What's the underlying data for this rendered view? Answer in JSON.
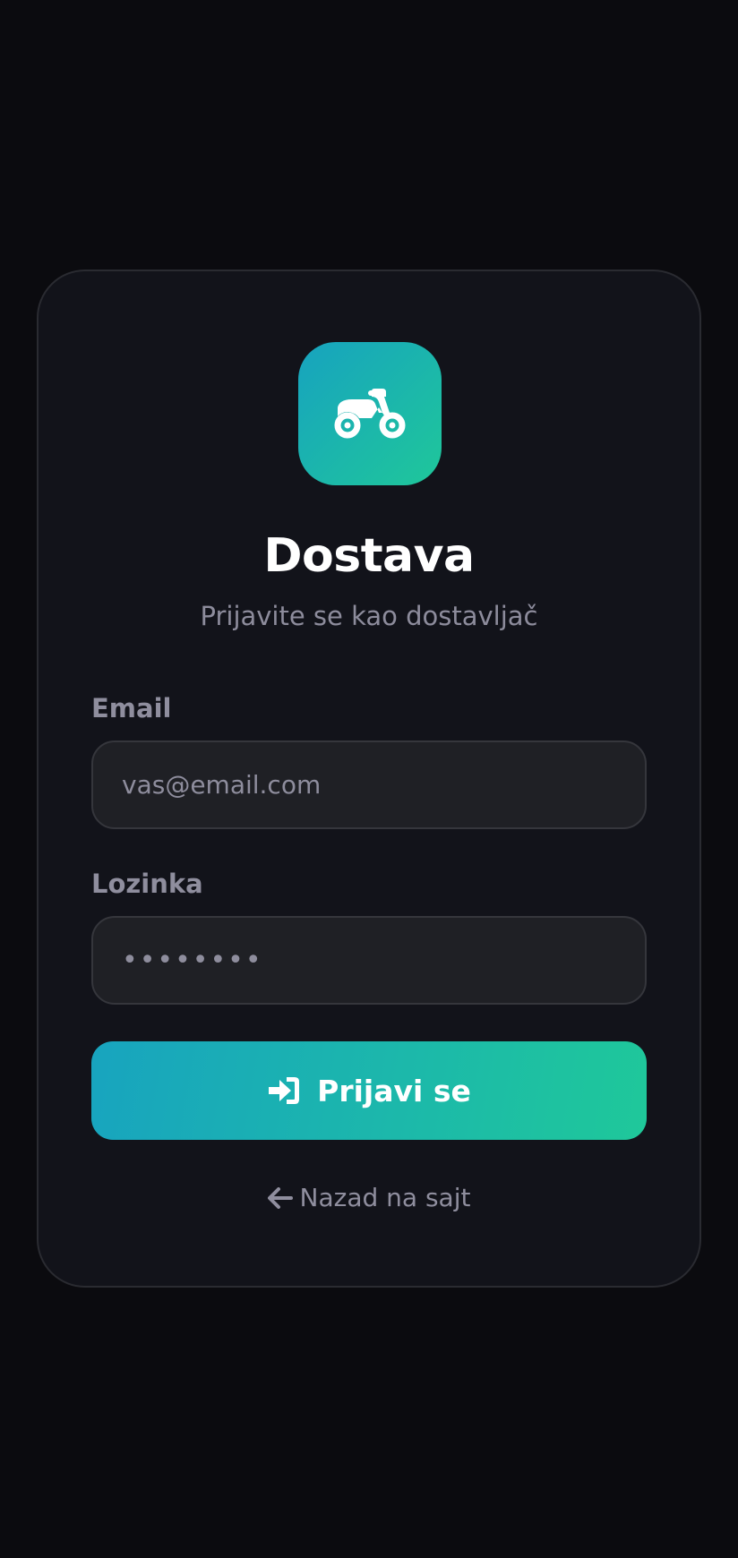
{
  "brand": {
    "title": "Dostava",
    "subtitle": "Prijavite se kao dostavljač",
    "logo_icon": "motorcycle-icon"
  },
  "form": {
    "email": {
      "label": "Email",
      "placeholder": "vas@email.com",
      "value": ""
    },
    "password": {
      "label": "Lozinka",
      "placeholder": "••••••••",
      "value": ""
    },
    "submit": {
      "label": "Prijavi se",
      "icon": "sign-in-icon"
    }
  },
  "back_link": {
    "label": "Nazad na sajt",
    "icon": "arrow-left-icon"
  },
  "colors": {
    "background": "#0b0b0f",
    "card": "#12131a",
    "accent_start": "#17a3bf",
    "accent_end": "#1fc79a",
    "muted_text": "#8f8e9e"
  }
}
